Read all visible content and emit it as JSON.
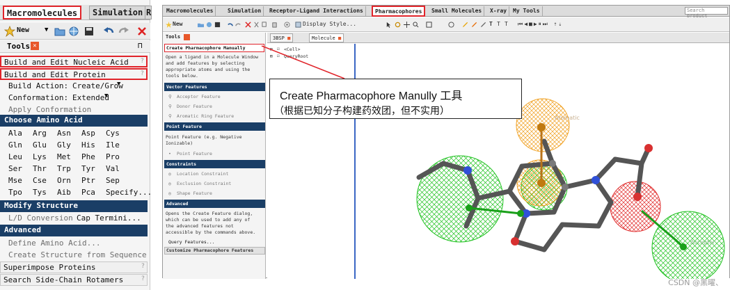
{
  "left_panel": {
    "tabs": [
      "Macromolecules",
      "Simulation",
      "R"
    ],
    "toolbar": {
      "new_label": "New"
    },
    "title": "Tools",
    "rows_top": [
      "Build and Edit Nucleic Acid",
      "Build and Edit Protein"
    ],
    "build_action": {
      "label": "Build Action:",
      "value": "Create/Grow"
    },
    "conformation": {
      "label": "Conformation:",
      "value": "Extended"
    },
    "apply_conformation": "Apply Conformation",
    "choose_amino_acid": "Choose Amino Acid",
    "amino_acids": [
      "Ala",
      "Arg",
      "Asn",
      "Asp",
      "Cys",
      "Gln",
      "Glu",
      "Gly",
      "His",
      "Ile",
      "Leu",
      "Lys",
      "Met",
      "Phe",
      "Pro",
      "Ser",
      "Thr",
      "Trp",
      "Tyr",
      "Val",
      "Mse",
      "Cse",
      "Orn",
      "Ptr",
      "Sep",
      "Tpo",
      "Tys",
      "Aib",
      "Pca",
      "Specify..."
    ],
    "modify_structure": "Modify Structure",
    "ld_conversion": "L/D Conversion",
    "cap_termini": "Cap Termini...",
    "advanced": "Advanced",
    "define_amino_acid": "Define Amino Acid...",
    "create_structure": "Create Structure from Sequence",
    "superimpose": "Superimpose Proteins",
    "search_rotamers": "Search Side-Chain Rotamers",
    "help_mark": "?"
  },
  "app": {
    "tabs": [
      "Macromolecules",
      "Simulation",
      "Receptor-Ligand Interactions",
      "Pharmacophores",
      "Small Molecules",
      "X-ray",
      "My Tools"
    ],
    "search_placeholder": "Search product",
    "toolbar_new": "New",
    "display_style": "Display Style...",
    "tools_title": "Tools",
    "create_manually": "Create Pharmacophore Manually",
    "intro": [
      "Open a ligand in a Molecule Window",
      "and add features by selecting",
      "appropriate atoms and using the",
      "tools below."
    ],
    "vector_features": "Vector Features",
    "vector_items": [
      "Acceptor Feature",
      "Donor Feature",
      "Aromatic Ring Feature"
    ],
    "point_features": "Point Feature",
    "point_desc": [
      "Point Feature (e.g. Negative",
      "Ionizable)"
    ],
    "point_item": "Point Feature",
    "constraints": "Constraints",
    "constraint_items": [
      "Location Constraint",
      "Exclusion Constraint",
      "Shape Feature"
    ],
    "advanced": "Advanced",
    "advanced_desc": [
      "Opens the Create Feature dialog,",
      "which can be used to add any of",
      "the advanced features not",
      "accessible by the commands above."
    ],
    "query_features": "Query Features...",
    "customize": "Customize Pharmacophore Features",
    "viewer_tabs": [
      "3BSP",
      "Molecule"
    ],
    "tree": [
      "<Cell>",
      "QueryRoot"
    ],
    "label_aromatic": "Aromatic",
    "label_acceptor": "Acceptor"
  },
  "callout": {
    "line1": "Create Pharmacophore Manully    工具",
    "line2": "（根据已知分子构建药效团，但不实用）"
  },
  "watermark": "CSDN @黑曜、"
}
